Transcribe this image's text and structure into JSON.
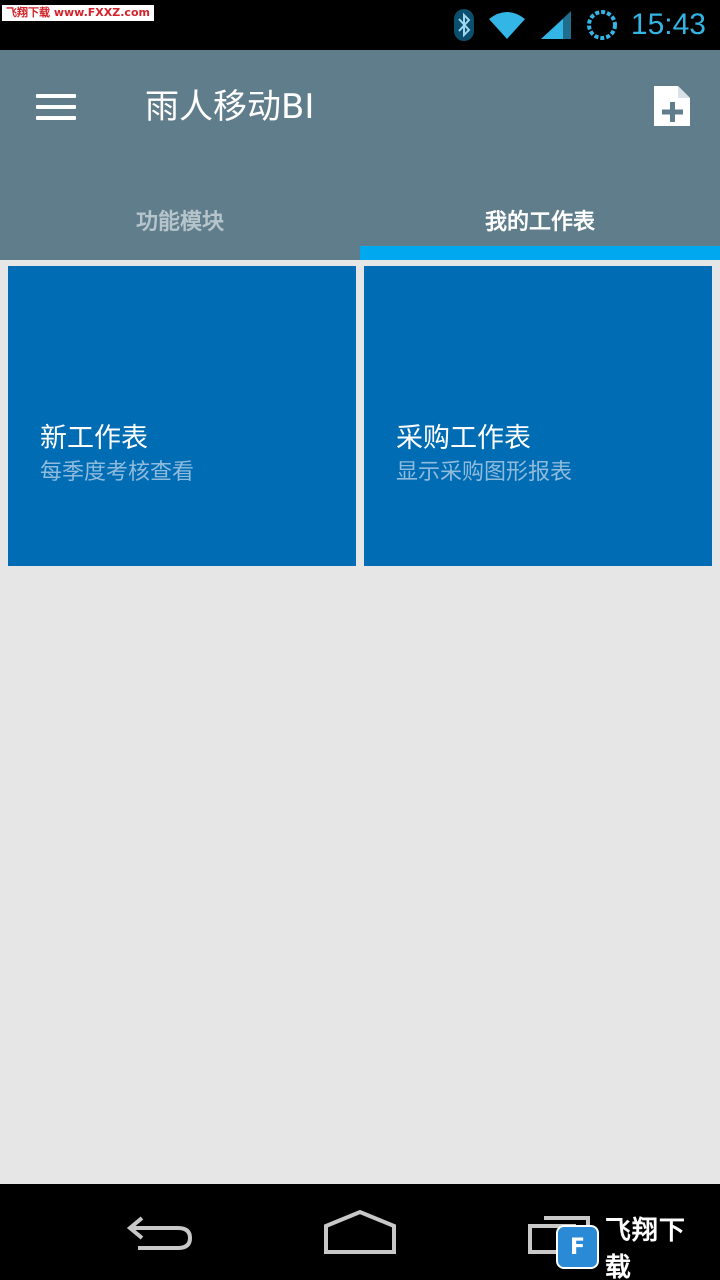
{
  "status_bar": {
    "watermark": "飞翔下载 www.FXXZ.com",
    "time": "15:43",
    "icons": [
      "bluetooth-icon",
      "wifi-icon",
      "signal-icon",
      "sync-icon"
    ]
  },
  "app_bar": {
    "title": "雨人移动BI",
    "menu_icon": "menu-icon",
    "add_icon": "add-document-icon"
  },
  "tabs": [
    {
      "label": "功能模块",
      "active": false
    },
    {
      "label": "我的工作表",
      "active": true
    }
  ],
  "tiles": [
    {
      "title": "新工作表",
      "subtitle": "每季度考核查看"
    },
    {
      "title": "采购工作表",
      "subtitle": "显示采购图形报表"
    }
  ],
  "nav_bar": {
    "icons": [
      "back-icon",
      "home-icon",
      "recents-icon"
    ],
    "watermark": "飞翔下载"
  },
  "colors": {
    "app_bar": "#607d8b",
    "tab_indicator": "#00a8f0",
    "tile": "#006cb4",
    "background": "#e6e6e6",
    "status_time": "#33b5e5"
  }
}
